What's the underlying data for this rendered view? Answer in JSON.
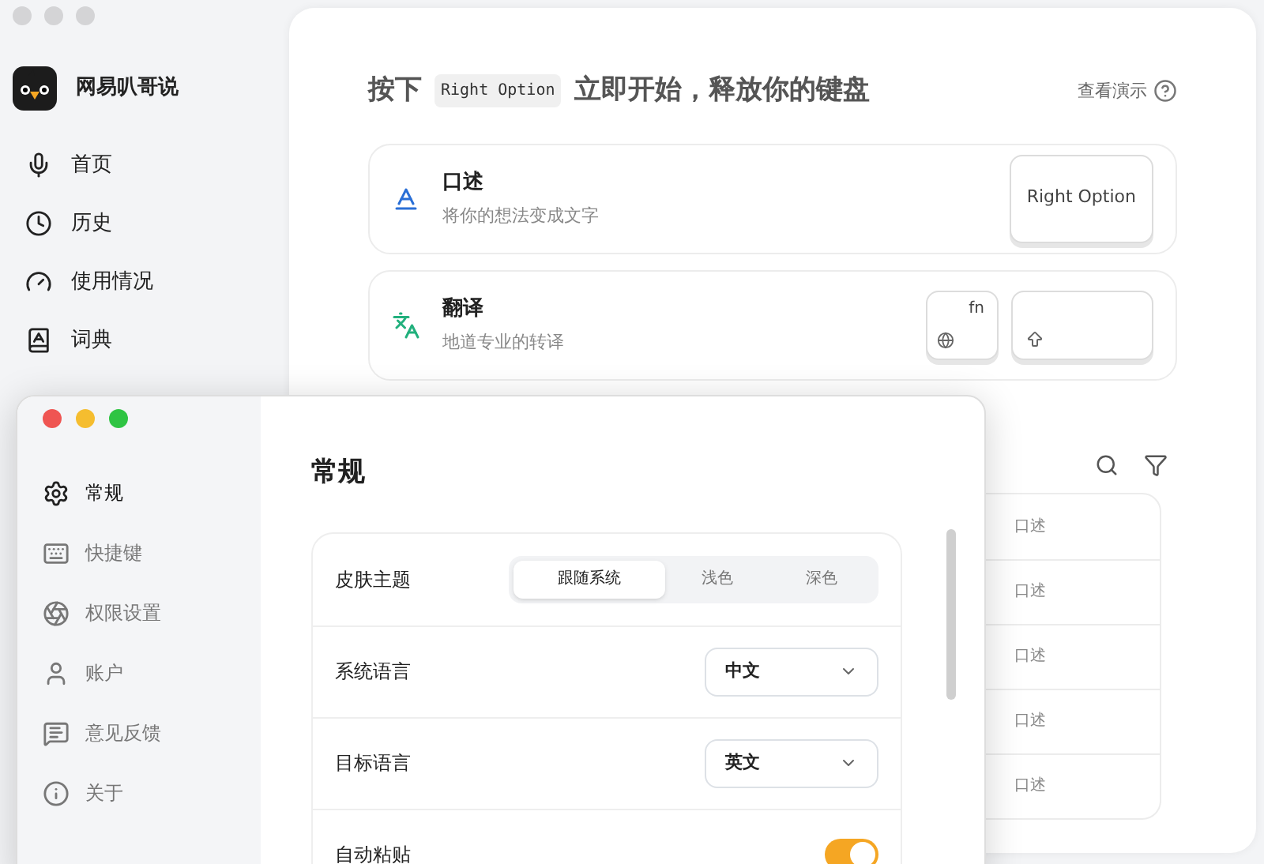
{
  "app": {
    "name": "网易叭哥说"
  },
  "sidebar": {
    "items": [
      {
        "label": "首页"
      },
      {
        "label": "历史"
      },
      {
        "label": "使用情况"
      },
      {
        "label": "词典"
      }
    ]
  },
  "home": {
    "headline_before": "按下",
    "headline_key": "Right Option",
    "headline_after": "立即开始，释放你的键盘",
    "demo_link": "查看演示",
    "modes": [
      {
        "kind": "dictate",
        "title": "口述",
        "description": "将你的想法变成文字",
        "keys": [
          {
            "kind": "text",
            "label": "Right Option"
          }
        ]
      },
      {
        "kind": "translate",
        "title": "翻译",
        "description": "地道专业的转译",
        "keys": [
          {
            "kind": "fn",
            "label": "fn"
          },
          {
            "kind": "shift"
          }
        ]
      }
    ],
    "history": [
      {
        "mode": "口述"
      },
      {
        "mode": "口述"
      },
      {
        "mode": "口述"
      },
      {
        "mode": "口述"
      },
      {
        "mode": "口述"
      }
    ]
  },
  "settings_window": {
    "sidebar": [
      {
        "label": "常规",
        "selected": true
      },
      {
        "label": "快捷键",
        "selected": false
      },
      {
        "label": "权限设置",
        "selected": false
      },
      {
        "label": "账户",
        "selected": false
      },
      {
        "label": "意见反馈",
        "selected": false
      },
      {
        "label": "关于",
        "selected": false
      }
    ],
    "title": "常规",
    "rows": [
      {
        "kind": "segmented",
        "label": "皮肤主题",
        "options": [
          {
            "label": "跟随系统",
            "selected": true
          },
          {
            "label": "浅色",
            "selected": false
          },
          {
            "label": "深色",
            "selected": false
          }
        ]
      },
      {
        "kind": "select",
        "label": "系统语言",
        "value": "中文"
      },
      {
        "kind": "select",
        "label": "目标语言",
        "value": "英文"
      },
      {
        "kind": "toggle",
        "label": "自动粘贴",
        "on": true
      }
    ]
  }
}
